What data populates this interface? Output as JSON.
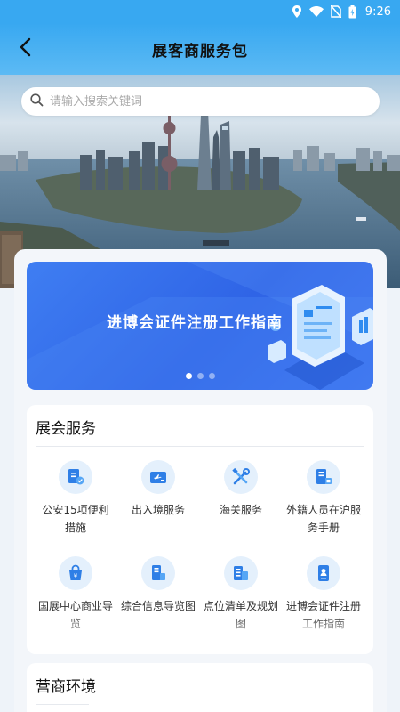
{
  "status_bar": {
    "time": "9:26",
    "icons": [
      "location-icon",
      "wifi-icon",
      "no-sim-icon",
      "battery-charging-icon"
    ]
  },
  "header": {
    "title": "展客商服务包",
    "back_icon": "chevron-left-icon"
  },
  "search": {
    "placeholder": "请输入搜索关键词",
    "icon": "search-icon"
  },
  "banner": {
    "text": "进博会证件注册工作指南",
    "slide_count": 3,
    "active_slide": 0
  },
  "services": {
    "title": "展会服务",
    "items": [
      {
        "label": "公安15项便利措施",
        "icon": "police-doc-icon"
      },
      {
        "label": "出入境服务",
        "icon": "boarding-pass-icon"
      },
      {
        "label": "海关服务",
        "icon": "tools-icon"
      },
      {
        "label": "外籍人员在沪服务手册",
        "icon": "handbook-icon"
      },
      {
        "label": "国展中心商业导览",
        "icon": "shopping-bag-icon"
      },
      {
        "label": "综合信息导览图",
        "icon": "info-map-icon"
      },
      {
        "label": "点位清单及规划图",
        "icon": "checklist-icon"
      },
      {
        "label": "进博会证件注册工作指南",
        "icon": "id-badge-icon"
      }
    ]
  },
  "business": {
    "title": "营商环境"
  },
  "colors": {
    "primary": "#38a8f1",
    "banner": "#3470ec",
    "icon_blue": "#2f7fe6",
    "icon_bg": "#e4f0fc"
  }
}
